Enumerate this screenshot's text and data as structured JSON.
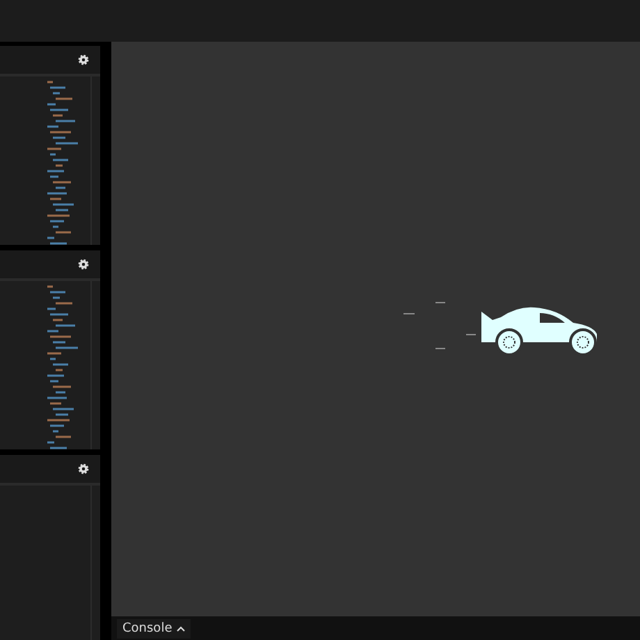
{
  "editors": [
    {
      "kind": "code"
    },
    {
      "kind": "code"
    },
    {
      "kind": "empty"
    }
  ],
  "console": {
    "label": "Console"
  }
}
